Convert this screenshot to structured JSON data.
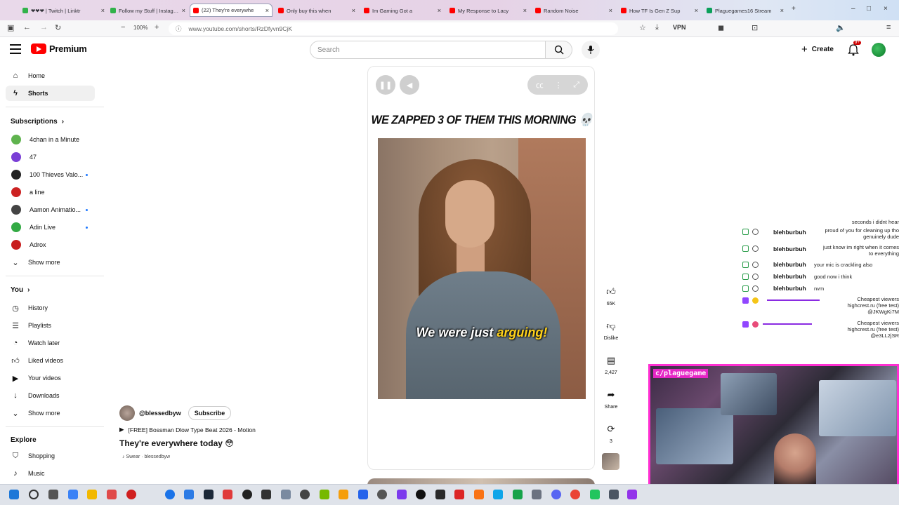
{
  "browser": {
    "tabs": [
      {
        "label": "❤❤❤ | Twitch | Linktr",
        "color": "#31b24a"
      },
      {
        "label": "Follow my Stuff | Instagram",
        "color": "#31b24a"
      },
      {
        "label": "(22) They're everywhe",
        "color": "#ff0000",
        "active": true
      },
      {
        "label": "Only buy this when",
        "color": "#ff0000"
      },
      {
        "label": "Im Gaming Got a",
        "color": "#ff0000"
      },
      {
        "label": "My Response to Lacy",
        "color": "#ff0000"
      },
      {
        "label": "Random Noise",
        "color": "#ff0000"
      },
      {
        "label": "How TF Is Gen Z Sup",
        "color": "#ff0000"
      },
      {
        "label": "Plaguegames16 Stream",
        "color": "#0aa05a"
      }
    ],
    "zoom": "100%",
    "url": "www.youtube.com/shorts/RzDfyvn9CjK",
    "vpn": "VPN"
  },
  "header": {
    "logo_text": "Premium",
    "search_placeholder": "Search",
    "create_label": "Create",
    "notif_badge": "9+"
  },
  "sidebar": {
    "home": "Home",
    "shorts": "Shorts",
    "subscriptions_title": "Subscriptions",
    "subscriptions": [
      {
        "name": "4chan in a Minute",
        "color": "#5fb34e",
        "dot": false
      },
      {
        "name": "47",
        "color": "#7a3fd6",
        "dot": false
      },
      {
        "name": "100 Thieves Valo...",
        "color": "#222222",
        "dot": true
      },
      {
        "name": "a line",
        "color": "#cc2222",
        "dot": false
      },
      {
        "name": "Aamon Animatio...",
        "color": "#444444",
        "dot": true
      },
      {
        "name": "Adin Live",
        "color": "#33aa44",
        "dot": true
      },
      {
        "name": "Adrox",
        "color": "#c81e1e",
        "dot": false
      }
    ],
    "show_more_1": "Show more",
    "you_title": "You",
    "you_items": [
      "History",
      "Playlists",
      "Watch later",
      "Liked videos",
      "Your videos",
      "Downloads"
    ],
    "show_more_2": "Show more",
    "explore_title": "Explore",
    "explore_items": [
      "Shopping",
      "Music"
    ]
  },
  "short": {
    "headline": "WE ZAPPED 3 OF THEM THIS MORNING 💀",
    "caption_a": "We were just ",
    "caption_b": "arguing!",
    "likes": "65K",
    "dislike": "Dislike",
    "comments": "2,427",
    "share": "Share",
    "remix": "3"
  },
  "meta": {
    "channel": "@blessedbyw",
    "subscribe": "Subscribe",
    "song": "[FREE] Bossman Dlow Type Beat 2026 - Motion",
    "title": "They're everywhere today 😳",
    "sound": "Swear · blessedbyw"
  },
  "chat": [
    {
      "user": "",
      "msg": "seconds i didnt hear"
    },
    {
      "user": "blehburbuh",
      "msg": "proud of you for cleaning up tho genuinely dude"
    },
    {
      "user": "blehburbuh",
      "msg": "just know im right when it comes to everything"
    },
    {
      "user": "blehburbuh",
      "msg": "your mic is crackling also"
    },
    {
      "user": "blehburbuh",
      "msg": "good now i think"
    },
    {
      "user": "blehburbuh",
      "msg": "nvm"
    },
    {
      "user": "",
      "msg": "Cheapest viewers highcrest.ru (free test) @JKWgKi7M"
    },
    {
      "user": "",
      "msg": "Cheapest viewers highcrest.ru (free test) @e3LL2jSR"
    }
  ],
  "cam": {
    "label": "c/plaguegame"
  }
}
